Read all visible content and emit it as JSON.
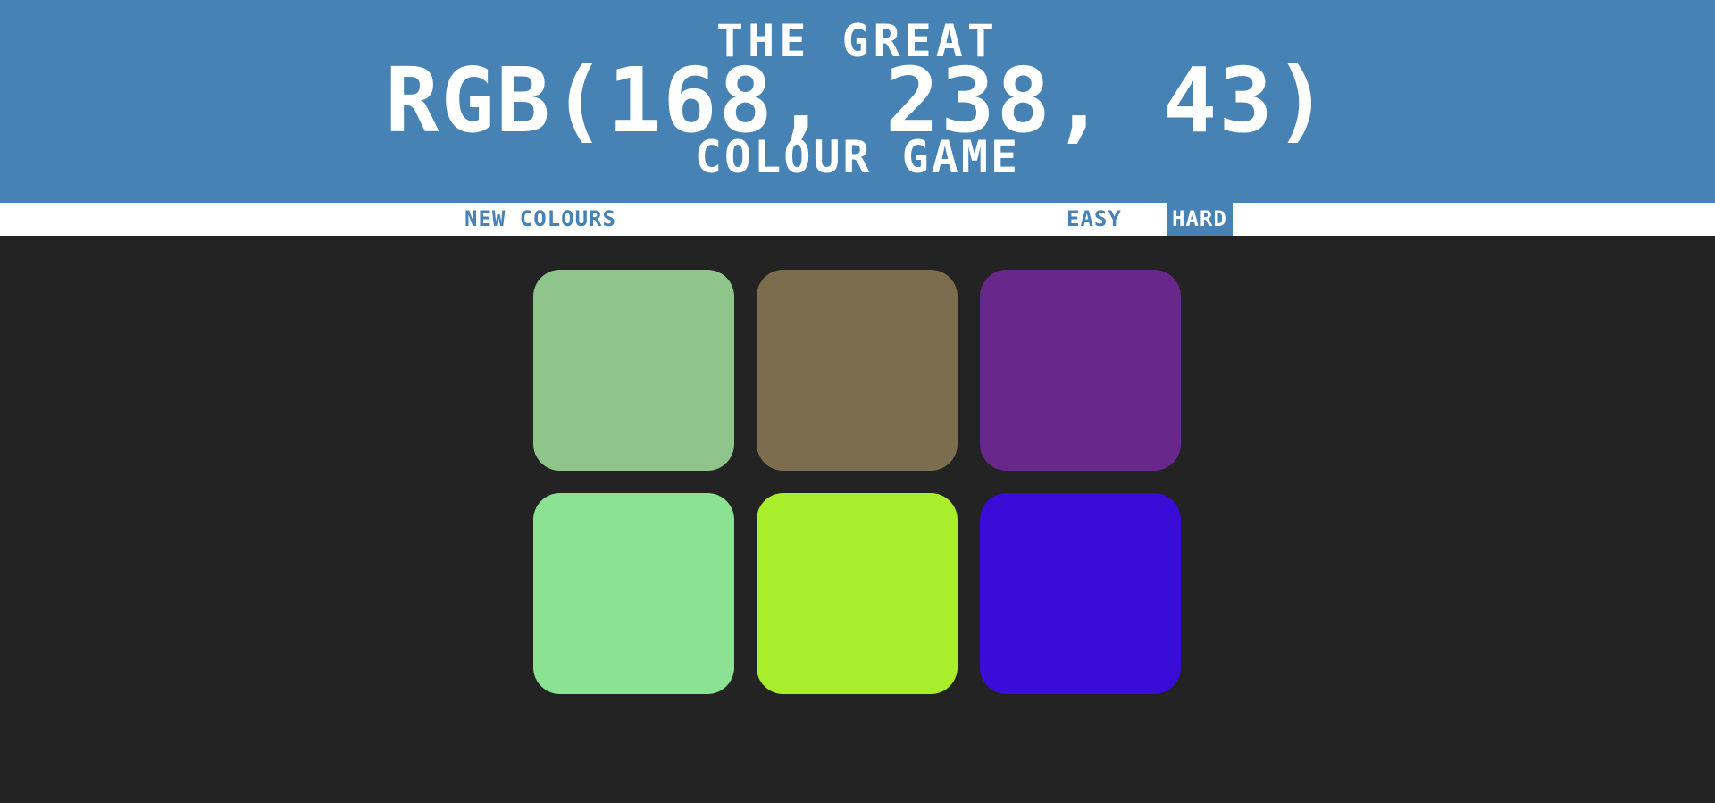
{
  "header": {
    "title_top": "THE GREAT",
    "target_rgb": "RGB(168, 238, 43)",
    "title_bottom": "COLOUR GAME",
    "background_color": "#4682b4"
  },
  "controls": {
    "new_colours_label": "NEW COLOURS",
    "easy_label": "EASY",
    "hard_label": "HARD",
    "selected_mode": "HARD",
    "message": ""
  },
  "board": {
    "background_color": "#232323",
    "squares": [
      {
        "color": "#8fc48b"
      },
      {
        "color": "#7b6d4d"
      },
      {
        "color": "#68278a"
      },
      {
        "color": "#8be292"
      },
      {
        "color": "#a8ee2b"
      },
      {
        "color": "#390cd8"
      }
    ]
  }
}
